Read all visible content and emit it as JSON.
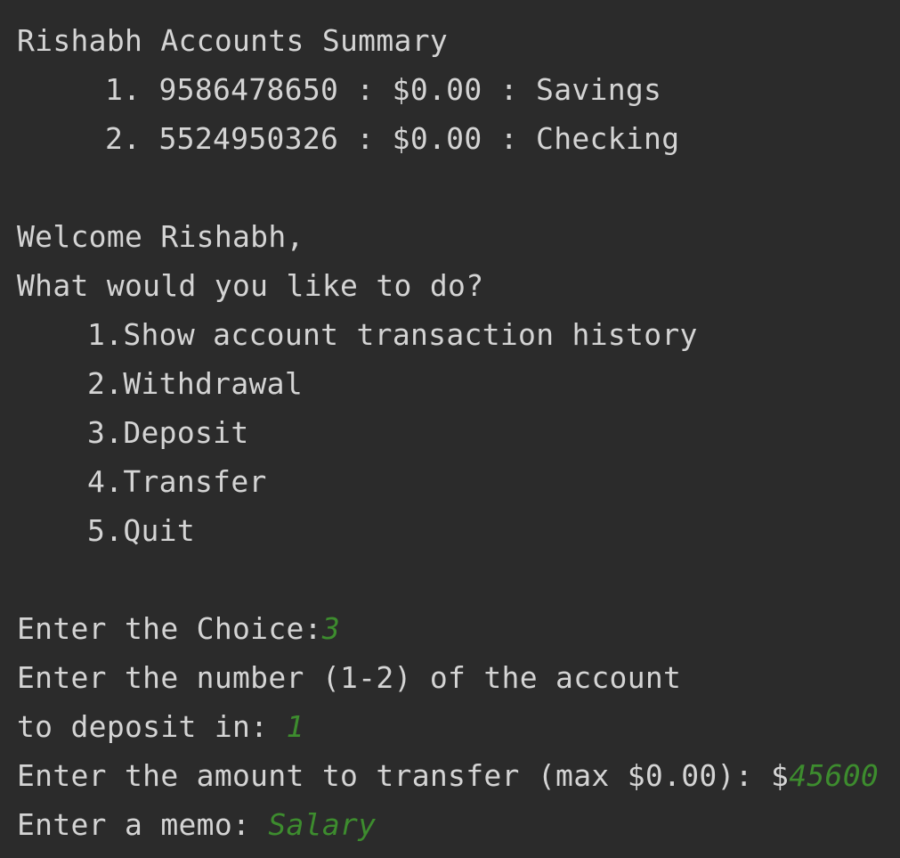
{
  "console": {
    "summary_title": "Rishabh Accounts Summary",
    "accounts": [
      {
        "line": "1. 9586478650 : $0.00 : Savings"
      },
      {
        "line": "2. 5524950326 : $0.00 : Checking"
      }
    ],
    "welcome": "Welcome Rishabh,",
    "question": "What would you like to do?",
    "menu": [
      {
        "label": "1.Show account transaction history"
      },
      {
        "label": "2.Withdrawal"
      },
      {
        "label": "3.Deposit"
      },
      {
        "label": "4.Transfer"
      },
      {
        "label": "5.Quit"
      }
    ],
    "choice_prompt": "Enter the Choice:",
    "choice_input": "3",
    "account_prompt_line1": "Enter the number (1-2) of the account",
    "account_prompt_line2": "to deposit in: ",
    "account_input": "1",
    "amount_prompt": "Enter the amount to transfer (max $0.00): $",
    "amount_input": "45600",
    "memo_prompt": "Enter a memo: ",
    "memo_input": "Salary"
  },
  "colors": {
    "background": "#2b2b2b",
    "output_text": "#d4d4d4",
    "user_input": "#3d8c2e"
  }
}
